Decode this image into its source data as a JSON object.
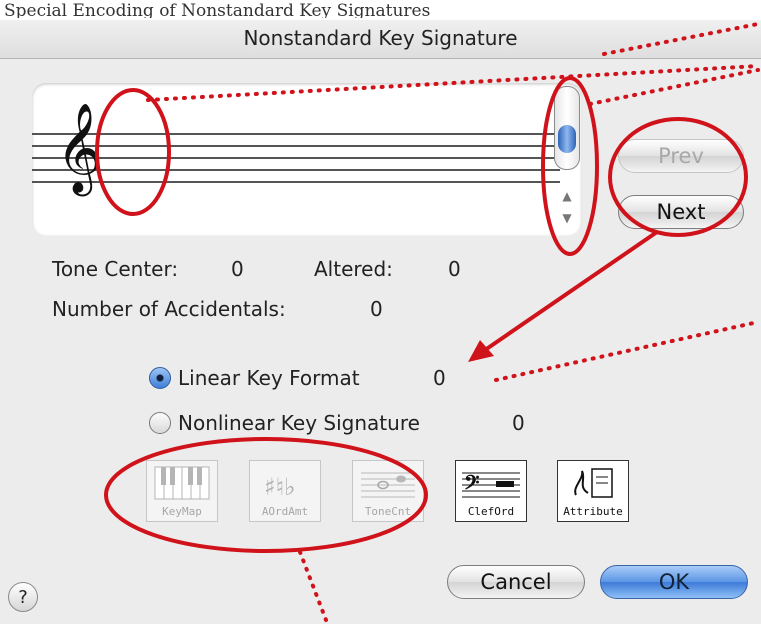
{
  "caption_text": "Special Encoding of Nonstandard Key Signatures",
  "window": {
    "title": "Nonstandard Key Signature"
  },
  "staff": {
    "clef_glyph": "𝄞",
    "clef_icon": "treble-clef-icon"
  },
  "scrollbar": {
    "up_glyph": "▲",
    "down_glyph": "▼"
  },
  "buttons": {
    "prev": "Prev",
    "next": "Next",
    "cancel": "Cancel",
    "ok": "OK",
    "help": "?"
  },
  "info": {
    "tone_center_label": "Tone Center:",
    "tone_center_value": "0",
    "altered_label": "Altered:",
    "altered_value": "0",
    "num_accidentals_label": "Number of Accidentals:",
    "num_accidentals_value": "0"
  },
  "radios": [
    {
      "label": "Linear Key Format",
      "value": "0",
      "selected": true
    },
    {
      "label": "Nonlinear Key Signature",
      "value": "0",
      "selected": false
    }
  ],
  "tools": [
    {
      "caption": "KeyMap",
      "icon": "keyboard-icon",
      "enabled": false
    },
    {
      "caption": "AOrdAmt",
      "icon": "accidentals-icon",
      "enabled": false
    },
    {
      "caption": "ToneCnt",
      "icon": "tone-center-icon",
      "enabled": false
    },
    {
      "caption": "ClefOrd",
      "icon": "clef-order-icon",
      "enabled": true
    },
    {
      "caption": "Attribute",
      "icon": "attribute-icon",
      "enabled": true
    }
  ],
  "colors": {
    "annotation": "#d0121b",
    "ok_button": "#5b95e6",
    "dialog_bg": "#ececec"
  }
}
